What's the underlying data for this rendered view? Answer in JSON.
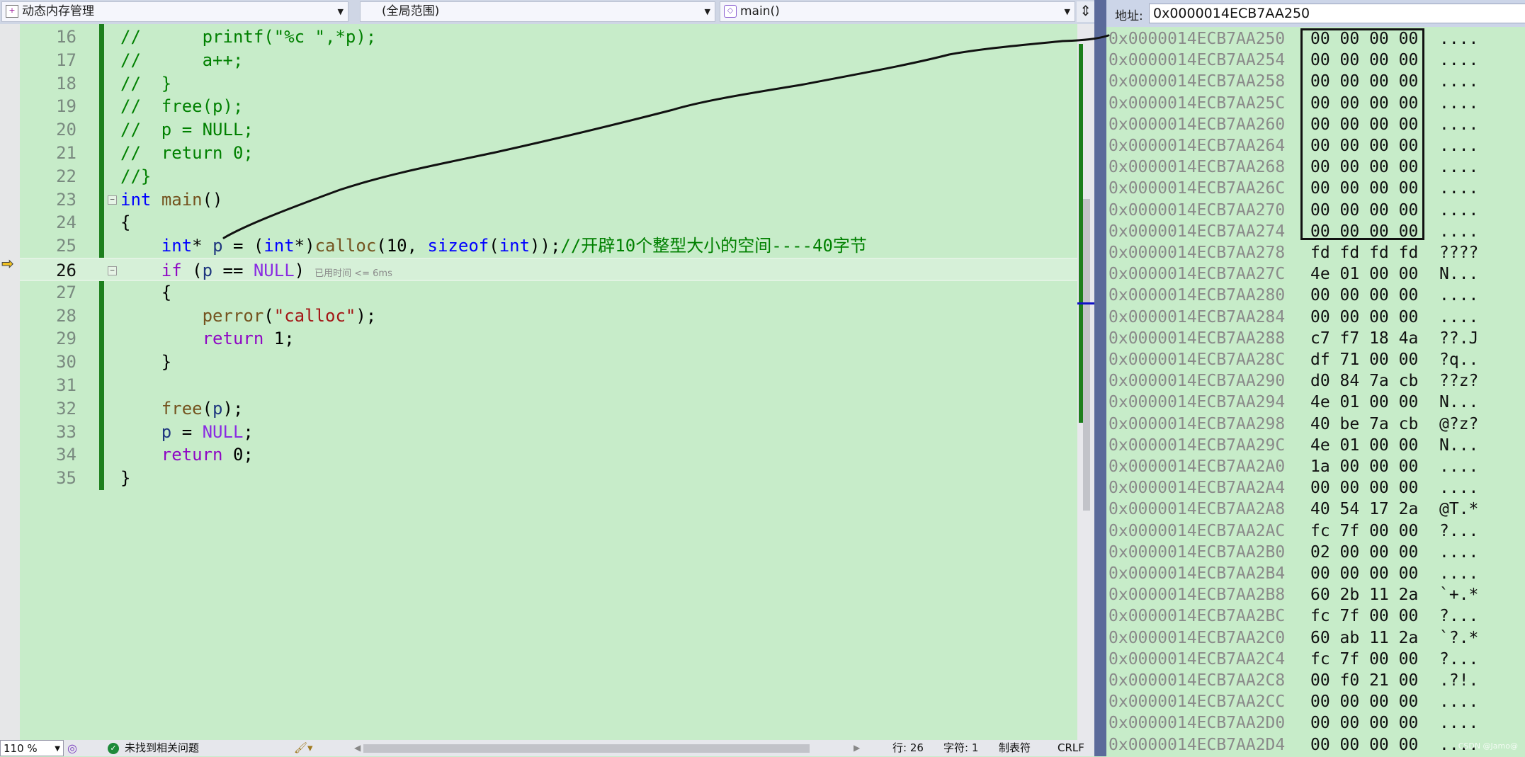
{
  "toolbar": {
    "project": "动态内存管理",
    "scope": "(全局范围)",
    "function": "main()"
  },
  "editor": {
    "lines": [
      {
        "n": "16",
        "t": [
          [
            "//      printf(\"%c \",*p);",
            "c-com"
          ]
        ]
      },
      {
        "n": "17",
        "t": [
          [
            "//      a++;",
            "c-com"
          ]
        ]
      },
      {
        "n": "18",
        "t": [
          [
            "//  }",
            "c-com"
          ]
        ]
      },
      {
        "n": "19",
        "t": [
          [
            "//  free(p);",
            "c-com"
          ]
        ]
      },
      {
        "n": "20",
        "t": [
          [
            "//  p = NULL;",
            "c-com"
          ]
        ]
      },
      {
        "n": "21",
        "t": [
          [
            "//  return 0;",
            "c-com"
          ]
        ]
      },
      {
        "n": "22",
        "t": [
          [
            "//}",
            "c-com"
          ]
        ]
      },
      {
        "n": "23",
        "t": [
          [
            "int",
            "c-kw"
          ],
          [
            " ",
            "c-p"
          ],
          [
            "main",
            "c-fn"
          ],
          [
            "()",
            "c-p"
          ]
        ]
      },
      {
        "n": "24",
        "t": [
          [
            "{",
            "c-p"
          ]
        ]
      },
      {
        "n": "25",
        "t": [
          [
            "    ",
            "c-p"
          ],
          [
            "int",
            "c-kw"
          ],
          [
            "* ",
            "c-p"
          ],
          [
            "p",
            "c-var"
          ],
          [
            " = (",
            "c-p"
          ],
          [
            "int",
            "c-kw"
          ],
          [
            "*)",
            "c-p"
          ],
          [
            "calloc",
            "c-fn"
          ],
          [
            "(10, ",
            "c-p"
          ],
          [
            "sizeof",
            "c-kw"
          ],
          [
            "(",
            "c-p"
          ],
          [
            "int",
            "c-kw"
          ],
          [
            "));",
            "c-p"
          ],
          [
            "//开辟10个整型大小的空间----40字节",
            "c-com"
          ]
        ]
      },
      {
        "n": "26",
        "t": [
          [
            "    ",
            "c-p"
          ],
          [
            "if",
            "c-ctl"
          ],
          [
            " (",
            "c-p"
          ],
          [
            "p",
            "c-var"
          ],
          [
            " == ",
            "c-p"
          ],
          [
            "NULL",
            "c-mac"
          ],
          [
            ")",
            "c-p"
          ]
        ]
      },
      {
        "n": "27",
        "t": [
          [
            "    {",
            "c-p"
          ]
        ]
      },
      {
        "n": "28",
        "t": [
          [
            "        ",
            "c-p"
          ],
          [
            "perror",
            "c-fn"
          ],
          [
            "(",
            "c-p"
          ],
          [
            "\"calloc\"",
            "c-str"
          ],
          [
            ");",
            "c-p"
          ]
        ]
      },
      {
        "n": "29",
        "t": [
          [
            "        ",
            "c-p"
          ],
          [
            "return",
            "c-ctl"
          ],
          [
            " 1;",
            "c-p"
          ]
        ]
      },
      {
        "n": "30",
        "t": [
          [
            "    }",
            "c-p"
          ]
        ]
      },
      {
        "n": "31",
        "t": []
      },
      {
        "n": "32",
        "t": [
          [
            "    ",
            "c-p"
          ],
          [
            "free",
            "c-fn"
          ],
          [
            "(",
            "c-p"
          ],
          [
            "p",
            "c-var"
          ],
          [
            ");",
            "c-p"
          ]
        ]
      },
      {
        "n": "33",
        "t": [
          [
            "    ",
            "c-p"
          ],
          [
            "p",
            "c-var"
          ],
          [
            " = ",
            "c-p"
          ],
          [
            "NULL",
            "c-mac"
          ],
          [
            ";",
            "c-p"
          ]
        ]
      },
      {
        "n": "34",
        "t": [
          [
            "    ",
            "c-p"
          ],
          [
            "return",
            "c-ctl"
          ],
          [
            " 0;",
            "c-p"
          ]
        ]
      },
      {
        "n": "35",
        "t": [
          [
            "}",
            "c-p"
          ]
        ]
      }
    ],
    "current_line": "26",
    "perf_hint": "已用时间 <= 6ms"
  },
  "memory": {
    "address_label": "地址:",
    "address": "0x0000014ECB7AA250",
    "rows": [
      {
        "a": "0x0000014ECB7AA250",
        "h": "00 00 00 00",
        "s": "...."
      },
      {
        "a": "0x0000014ECB7AA254",
        "h": "00 00 00 00",
        "s": "...."
      },
      {
        "a": "0x0000014ECB7AA258",
        "h": "00 00 00 00",
        "s": "...."
      },
      {
        "a": "0x0000014ECB7AA25C",
        "h": "00 00 00 00",
        "s": "...."
      },
      {
        "a": "0x0000014ECB7AA260",
        "h": "00 00 00 00",
        "s": "...."
      },
      {
        "a": "0x0000014ECB7AA264",
        "h": "00 00 00 00",
        "s": "...."
      },
      {
        "a": "0x0000014ECB7AA268",
        "h": "00 00 00 00",
        "s": "...."
      },
      {
        "a": "0x0000014ECB7AA26C",
        "h": "00 00 00 00",
        "s": "...."
      },
      {
        "a": "0x0000014ECB7AA270",
        "h": "00 00 00 00",
        "s": "...."
      },
      {
        "a": "0x0000014ECB7AA274",
        "h": "00 00 00 00",
        "s": "...."
      },
      {
        "a": "0x0000014ECB7AA278",
        "h": "fd fd fd fd",
        "s": "????"
      },
      {
        "a": "0x0000014ECB7AA27C",
        "h": "4e 01 00 00",
        "s": "N..."
      },
      {
        "a": "0x0000014ECB7AA280",
        "h": "00 00 00 00",
        "s": "...."
      },
      {
        "a": "0x0000014ECB7AA284",
        "h": "00 00 00 00",
        "s": "...."
      },
      {
        "a": "0x0000014ECB7AA288",
        "h": "c7 f7 18 4a",
        "s": "??.J"
      },
      {
        "a": "0x0000014ECB7AA28C",
        "h": "df 71 00 00",
        "s": "?q.."
      },
      {
        "a": "0x0000014ECB7AA290",
        "h": "d0 84 7a cb",
        "s": "??z?"
      },
      {
        "a": "0x0000014ECB7AA294",
        "h": "4e 01 00 00",
        "s": "N..."
      },
      {
        "a": "0x0000014ECB7AA298",
        "h": "40 be 7a cb",
        "s": "@?z?"
      },
      {
        "a": "0x0000014ECB7AA29C",
        "h": "4e 01 00 00",
        "s": "N..."
      },
      {
        "a": "0x0000014ECB7AA2A0",
        "h": "1a 00 00 00",
        "s": "...."
      },
      {
        "a": "0x0000014ECB7AA2A4",
        "h": "00 00 00 00",
        "s": "...."
      },
      {
        "a": "0x0000014ECB7AA2A8",
        "h": "40 54 17 2a",
        "s": "@T.*"
      },
      {
        "a": "0x0000014ECB7AA2AC",
        "h": "fc 7f 00 00",
        "s": "?..."
      },
      {
        "a": "0x0000014ECB7AA2B0",
        "h": "02 00 00 00",
        "s": "...."
      },
      {
        "a": "0x0000014ECB7AA2B4",
        "h": "00 00 00 00",
        "s": "...."
      },
      {
        "a": "0x0000014ECB7AA2B8",
        "h": "60 2b 11 2a",
        "s": "`+.*"
      },
      {
        "a": "0x0000014ECB7AA2BC",
        "h": "fc 7f 00 00",
        "s": "?..."
      },
      {
        "a": "0x0000014ECB7AA2C0",
        "h": "60 ab 11 2a",
        "s": "`?.*"
      },
      {
        "a": "0x0000014ECB7AA2C4",
        "h": "fc 7f 00 00",
        "s": "?..."
      },
      {
        "a": "0x0000014ECB7AA2C8",
        "h": "00 f0 21 00",
        "s": ".?!."
      },
      {
        "a": "0x0000014ECB7AA2CC",
        "h": "00 00 00 00",
        "s": "...."
      },
      {
        "a": "0x0000014ECB7AA2D0",
        "h": "00 00 00 00",
        "s": "...."
      },
      {
        "a": "0x0000014ECB7AA2D4",
        "h": "00 00 00 00",
        "s": "...."
      }
    ],
    "watermark": "CSDN @Jamo@"
  },
  "status": {
    "zoom": "110 %",
    "issues": "未找到相关问题",
    "line": "行: 26",
    "char": "字符: 1",
    "tabs": "制表符",
    "eol": "CRLF"
  },
  "colors": {
    "editor_bg": "#c7ecc9",
    "comment": "#008000",
    "keyword": "#0000ff",
    "success": "#1e8a3a"
  }
}
